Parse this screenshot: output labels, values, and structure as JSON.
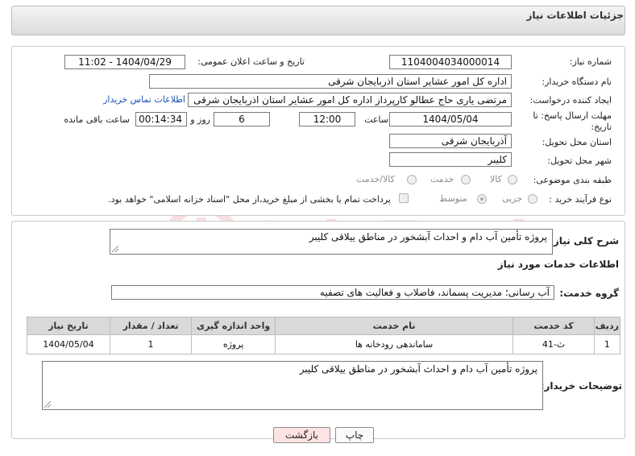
{
  "header": {
    "title": "جزئیات اطلاعات نیاز"
  },
  "form": {
    "need_number_label": "شماره نیاز:",
    "need_number": "1104004034000014",
    "announce_label": "تاریخ و ساعت اعلان عمومی:",
    "announce_value": "1404/04/29 - 11:02",
    "buyer_org_label": "نام دستگاه خریدار:",
    "buyer_org": "اداره کل امور عشایر استان اذربایجان شرقی",
    "creator_label": "ایجاد کننده درخواست:",
    "creator": "مرتضی یاری حاج عطالو کارپرداز اداره کل امور عشایر استان اذربایجان شرقی",
    "contact_link": "اطلاعات تماس خریدار",
    "deadline_label_1": "مهلت ارسال پاسخ: تا",
    "deadline_label_2": "تاریخ:",
    "deadline_date": "1404/05/04",
    "time_label": "ساعت",
    "deadline_time": "12:00",
    "days_value": "6",
    "days_label": "روز و",
    "remaining_time": "00:14:34",
    "remaining_label": "ساعت باقی مانده",
    "province_label": "استان محل تحویل:",
    "province": "آذربایجان شرقی",
    "city_label": "شهر محل تحویل:",
    "city": "کلیبر",
    "category_label": "طبقه بندی موضوعی:",
    "category_options": [
      "کالا",
      "خدمت",
      "کالا/خدمت"
    ],
    "process_label": "نوع فرآیند خرید :",
    "process_options": [
      "جزیی",
      "متوسط"
    ],
    "payment_note": "پرداخت تمام یا بخشی از مبلغ خرید،از محل \"اسناد خزانه اسلامی\" خواهد بود."
  },
  "description": {
    "label": "شرح کلی نیاز:",
    "text": "پروژه تأمین آب دام و احداث آبشخور در مناطق ییلاقی کلیبر"
  },
  "services": {
    "section_title": "اطلاعات خدمات مورد نیاز",
    "group_label": "گروه خدمت:",
    "group_value": "آب رسانی؛ مدیریت پسماند، فاضلاب و فعالیت های تصفیه"
  },
  "table": {
    "headers": [
      "ردیف",
      "کد خدمت",
      "نام خدمت",
      "واحد اندازه گیری",
      "تعداد / مقدار",
      "تاریخ نیاز"
    ],
    "rows": [
      [
        "1",
        "ث-41",
        "ساماندهی رودخانه ها",
        "پروژه",
        "1",
        "1404/05/04"
      ]
    ]
  },
  "buyer_notes": {
    "label": "توضیحات خریدار:",
    "text": "پروژه تأمین  آب دام و احداث آبشخور در مناطق ییلاقی کلیبر"
  },
  "buttons": {
    "print": "چاپ",
    "back": "بازگشت"
  },
  "colors": {
    "link": "#1a4fb5",
    "back_button_bg": "#fde3e3",
    "header_bg": "#e6e6e6"
  }
}
